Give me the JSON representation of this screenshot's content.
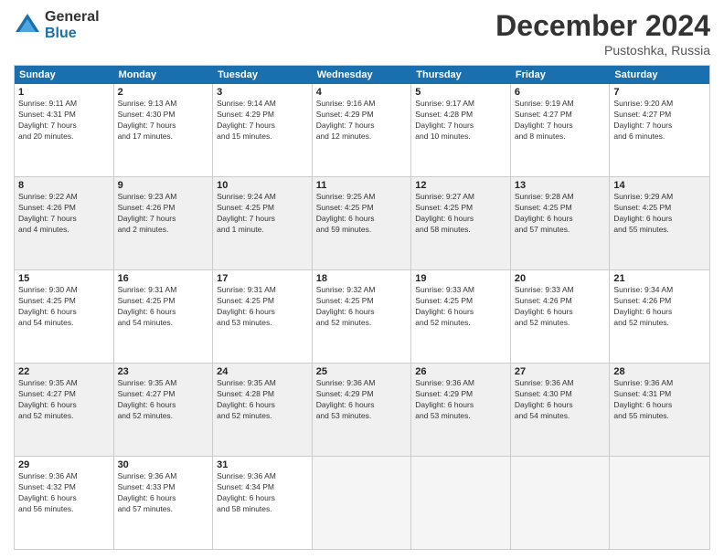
{
  "logo": {
    "general": "General",
    "blue": "Blue"
  },
  "title": {
    "month": "December 2024",
    "location": "Pustoshka, Russia"
  },
  "header_days": [
    "Sunday",
    "Monday",
    "Tuesday",
    "Wednesday",
    "Thursday",
    "Friday",
    "Saturday"
  ],
  "weeks": [
    [
      {
        "day": "1",
        "lines": [
          "Sunrise: 9:11 AM",
          "Sunset: 4:31 PM",
          "Daylight: 7 hours",
          "and 20 minutes."
        ],
        "shaded": false
      },
      {
        "day": "2",
        "lines": [
          "Sunrise: 9:13 AM",
          "Sunset: 4:30 PM",
          "Daylight: 7 hours",
          "and 17 minutes."
        ],
        "shaded": false
      },
      {
        "day": "3",
        "lines": [
          "Sunrise: 9:14 AM",
          "Sunset: 4:29 PM",
          "Daylight: 7 hours",
          "and 15 minutes."
        ],
        "shaded": false
      },
      {
        "day": "4",
        "lines": [
          "Sunrise: 9:16 AM",
          "Sunset: 4:29 PM",
          "Daylight: 7 hours",
          "and 12 minutes."
        ],
        "shaded": false
      },
      {
        "day": "5",
        "lines": [
          "Sunrise: 9:17 AM",
          "Sunset: 4:28 PM",
          "Daylight: 7 hours",
          "and 10 minutes."
        ],
        "shaded": false
      },
      {
        "day": "6",
        "lines": [
          "Sunrise: 9:19 AM",
          "Sunset: 4:27 PM",
          "Daylight: 7 hours",
          "and 8 minutes."
        ],
        "shaded": false
      },
      {
        "day": "7",
        "lines": [
          "Sunrise: 9:20 AM",
          "Sunset: 4:27 PM",
          "Daylight: 7 hours",
          "and 6 minutes."
        ],
        "shaded": false
      }
    ],
    [
      {
        "day": "8",
        "lines": [
          "Sunrise: 9:22 AM",
          "Sunset: 4:26 PM",
          "Daylight: 7 hours",
          "and 4 minutes."
        ],
        "shaded": true
      },
      {
        "day": "9",
        "lines": [
          "Sunrise: 9:23 AM",
          "Sunset: 4:26 PM",
          "Daylight: 7 hours",
          "and 2 minutes."
        ],
        "shaded": true
      },
      {
        "day": "10",
        "lines": [
          "Sunrise: 9:24 AM",
          "Sunset: 4:25 PM",
          "Daylight: 7 hours",
          "and 1 minute."
        ],
        "shaded": true
      },
      {
        "day": "11",
        "lines": [
          "Sunrise: 9:25 AM",
          "Sunset: 4:25 PM",
          "Daylight: 6 hours",
          "and 59 minutes."
        ],
        "shaded": true
      },
      {
        "day": "12",
        "lines": [
          "Sunrise: 9:27 AM",
          "Sunset: 4:25 PM",
          "Daylight: 6 hours",
          "and 58 minutes."
        ],
        "shaded": true
      },
      {
        "day": "13",
        "lines": [
          "Sunrise: 9:28 AM",
          "Sunset: 4:25 PM",
          "Daylight: 6 hours",
          "and 57 minutes."
        ],
        "shaded": true
      },
      {
        "day": "14",
        "lines": [
          "Sunrise: 9:29 AM",
          "Sunset: 4:25 PM",
          "Daylight: 6 hours",
          "and 55 minutes."
        ],
        "shaded": true
      }
    ],
    [
      {
        "day": "15",
        "lines": [
          "Sunrise: 9:30 AM",
          "Sunset: 4:25 PM",
          "Daylight: 6 hours",
          "and 54 minutes."
        ],
        "shaded": false
      },
      {
        "day": "16",
        "lines": [
          "Sunrise: 9:31 AM",
          "Sunset: 4:25 PM",
          "Daylight: 6 hours",
          "and 54 minutes."
        ],
        "shaded": false
      },
      {
        "day": "17",
        "lines": [
          "Sunrise: 9:31 AM",
          "Sunset: 4:25 PM",
          "Daylight: 6 hours",
          "and 53 minutes."
        ],
        "shaded": false
      },
      {
        "day": "18",
        "lines": [
          "Sunrise: 9:32 AM",
          "Sunset: 4:25 PM",
          "Daylight: 6 hours",
          "and 52 minutes."
        ],
        "shaded": false
      },
      {
        "day": "19",
        "lines": [
          "Sunrise: 9:33 AM",
          "Sunset: 4:25 PM",
          "Daylight: 6 hours",
          "and 52 minutes."
        ],
        "shaded": false
      },
      {
        "day": "20",
        "lines": [
          "Sunrise: 9:33 AM",
          "Sunset: 4:26 PM",
          "Daylight: 6 hours",
          "and 52 minutes."
        ],
        "shaded": false
      },
      {
        "day": "21",
        "lines": [
          "Sunrise: 9:34 AM",
          "Sunset: 4:26 PM",
          "Daylight: 6 hours",
          "and 52 minutes."
        ],
        "shaded": false
      }
    ],
    [
      {
        "day": "22",
        "lines": [
          "Sunrise: 9:35 AM",
          "Sunset: 4:27 PM",
          "Daylight: 6 hours",
          "and 52 minutes."
        ],
        "shaded": true
      },
      {
        "day": "23",
        "lines": [
          "Sunrise: 9:35 AM",
          "Sunset: 4:27 PM",
          "Daylight: 6 hours",
          "and 52 minutes."
        ],
        "shaded": true
      },
      {
        "day": "24",
        "lines": [
          "Sunrise: 9:35 AM",
          "Sunset: 4:28 PM",
          "Daylight: 6 hours",
          "and 52 minutes."
        ],
        "shaded": true
      },
      {
        "day": "25",
        "lines": [
          "Sunrise: 9:36 AM",
          "Sunset: 4:29 PM",
          "Daylight: 6 hours",
          "and 53 minutes."
        ],
        "shaded": true
      },
      {
        "day": "26",
        "lines": [
          "Sunrise: 9:36 AM",
          "Sunset: 4:29 PM",
          "Daylight: 6 hours",
          "and 53 minutes."
        ],
        "shaded": true
      },
      {
        "day": "27",
        "lines": [
          "Sunrise: 9:36 AM",
          "Sunset: 4:30 PM",
          "Daylight: 6 hours",
          "and 54 minutes."
        ],
        "shaded": true
      },
      {
        "day": "28",
        "lines": [
          "Sunrise: 9:36 AM",
          "Sunset: 4:31 PM",
          "Daylight: 6 hours",
          "and 55 minutes."
        ],
        "shaded": true
      }
    ],
    [
      {
        "day": "29",
        "lines": [
          "Sunrise: 9:36 AM",
          "Sunset: 4:32 PM",
          "Daylight: 6 hours",
          "and 56 minutes."
        ],
        "shaded": false
      },
      {
        "day": "30",
        "lines": [
          "Sunrise: 9:36 AM",
          "Sunset: 4:33 PM",
          "Daylight: 6 hours",
          "and 57 minutes."
        ],
        "shaded": false
      },
      {
        "day": "31",
        "lines": [
          "Sunrise: 9:36 AM",
          "Sunset: 4:34 PM",
          "Daylight: 6 hours",
          "and 58 minutes."
        ],
        "shaded": false
      },
      {
        "day": "",
        "lines": [],
        "shaded": true,
        "empty": true
      },
      {
        "day": "",
        "lines": [],
        "shaded": true,
        "empty": true
      },
      {
        "day": "",
        "lines": [],
        "shaded": true,
        "empty": true
      },
      {
        "day": "",
        "lines": [],
        "shaded": true,
        "empty": true
      }
    ]
  ]
}
